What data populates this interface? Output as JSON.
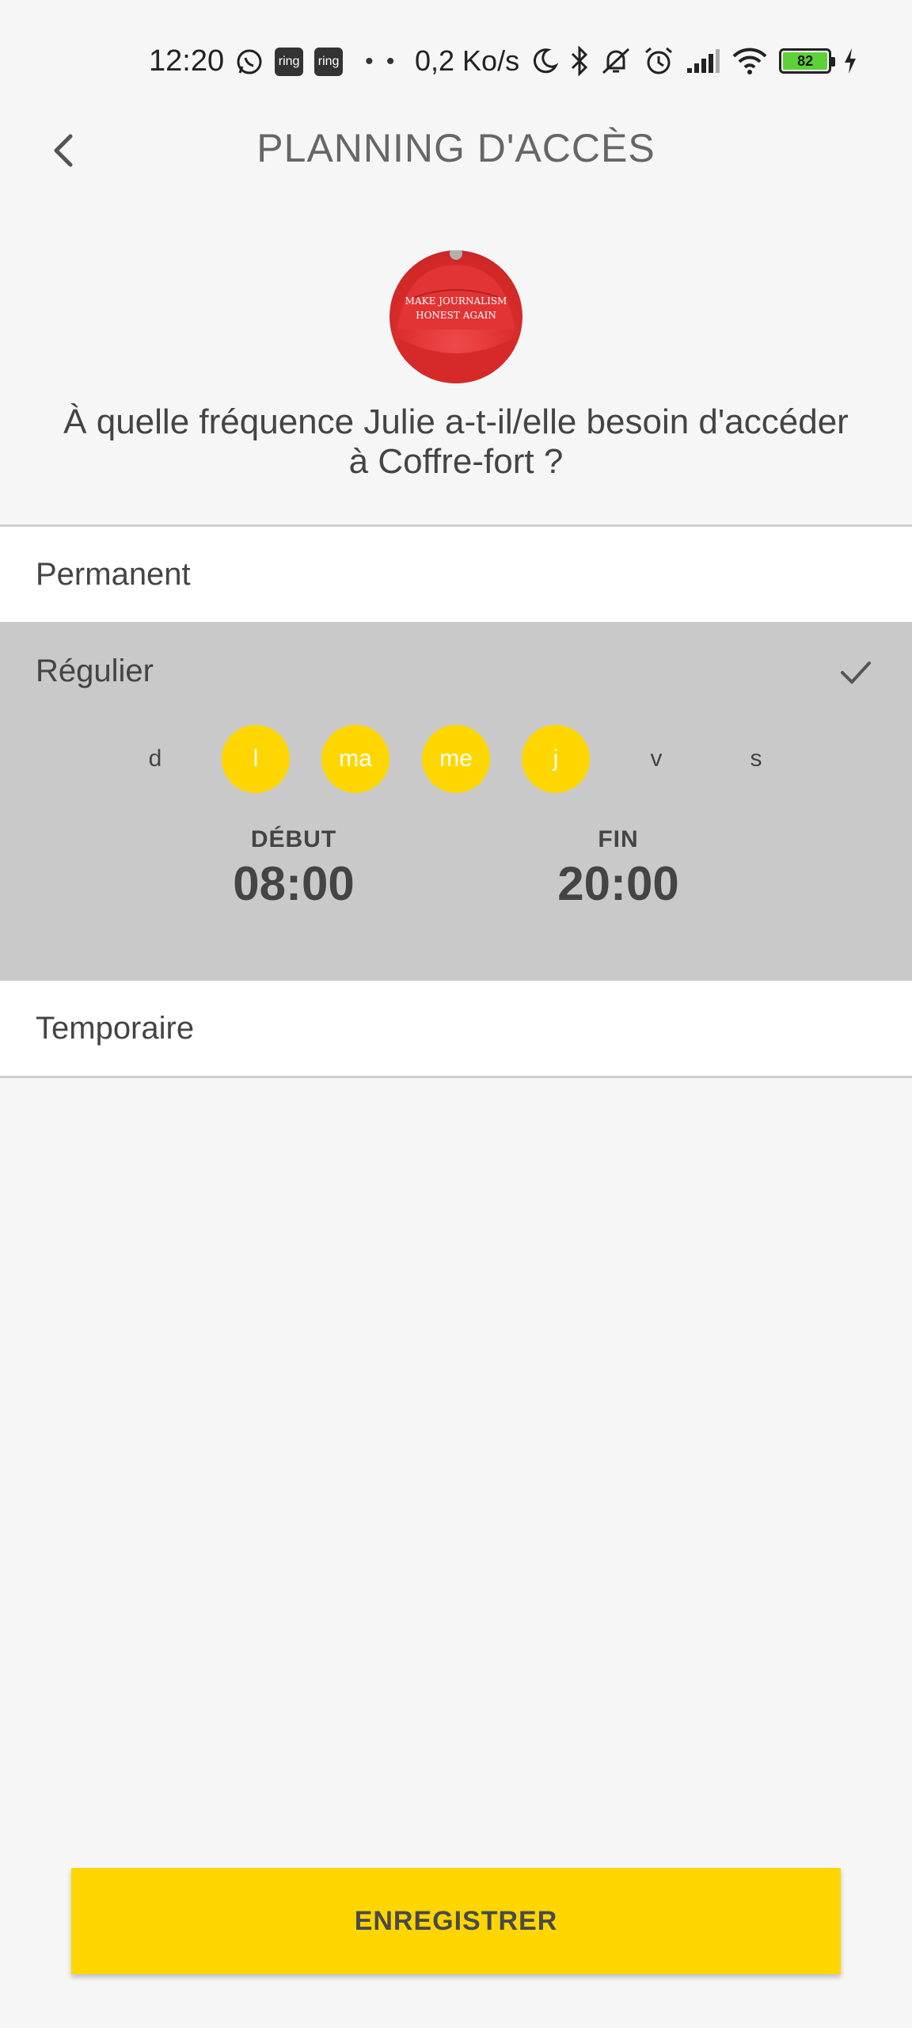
{
  "status_bar": {
    "time": "12:20",
    "ring_label_1": "ring",
    "ring_label_2": "ring",
    "network_speed": "0,2 Ko/s",
    "battery_level": "82",
    "icons": [
      "whatsapp-icon",
      "ring-icon",
      "ring-icon",
      "moon-icon",
      "bluetooth-icon",
      "muted-bell-icon",
      "alarm-icon",
      "signal-icon",
      "wifi-icon",
      "battery-icon",
      "charging-icon"
    ]
  },
  "header": {
    "title": "PLANNING D'ACCÈS"
  },
  "avatar": {
    "cap_text_line1": "MAKE JOURNALISM",
    "cap_text_line2": "HONEST AGAIN"
  },
  "question": "À quelle fréquence Julie a-t-il/elle besoin d'accéder à Coffre-fort ?",
  "options": {
    "permanent": "Permanent",
    "regulier": "Régulier",
    "temporaire": "Temporaire",
    "selected": "regulier"
  },
  "days": [
    {
      "label": "d",
      "selected": false
    },
    {
      "label": "l",
      "selected": true
    },
    {
      "label": "ma",
      "selected": true
    },
    {
      "label": "me",
      "selected": true
    },
    {
      "label": "j",
      "selected": true
    },
    {
      "label": "v",
      "selected": false
    },
    {
      "label": "s",
      "selected": false
    }
  ],
  "schedule": {
    "start_label": "DÉBUT",
    "start_time": "08:00",
    "end_label": "FIN",
    "end_time": "20:00"
  },
  "save_button": "ENREGISTRER",
  "colors": {
    "accent": "#ffd600",
    "selected_row": "#c9c9c9",
    "background": "#f6f6f6"
  }
}
